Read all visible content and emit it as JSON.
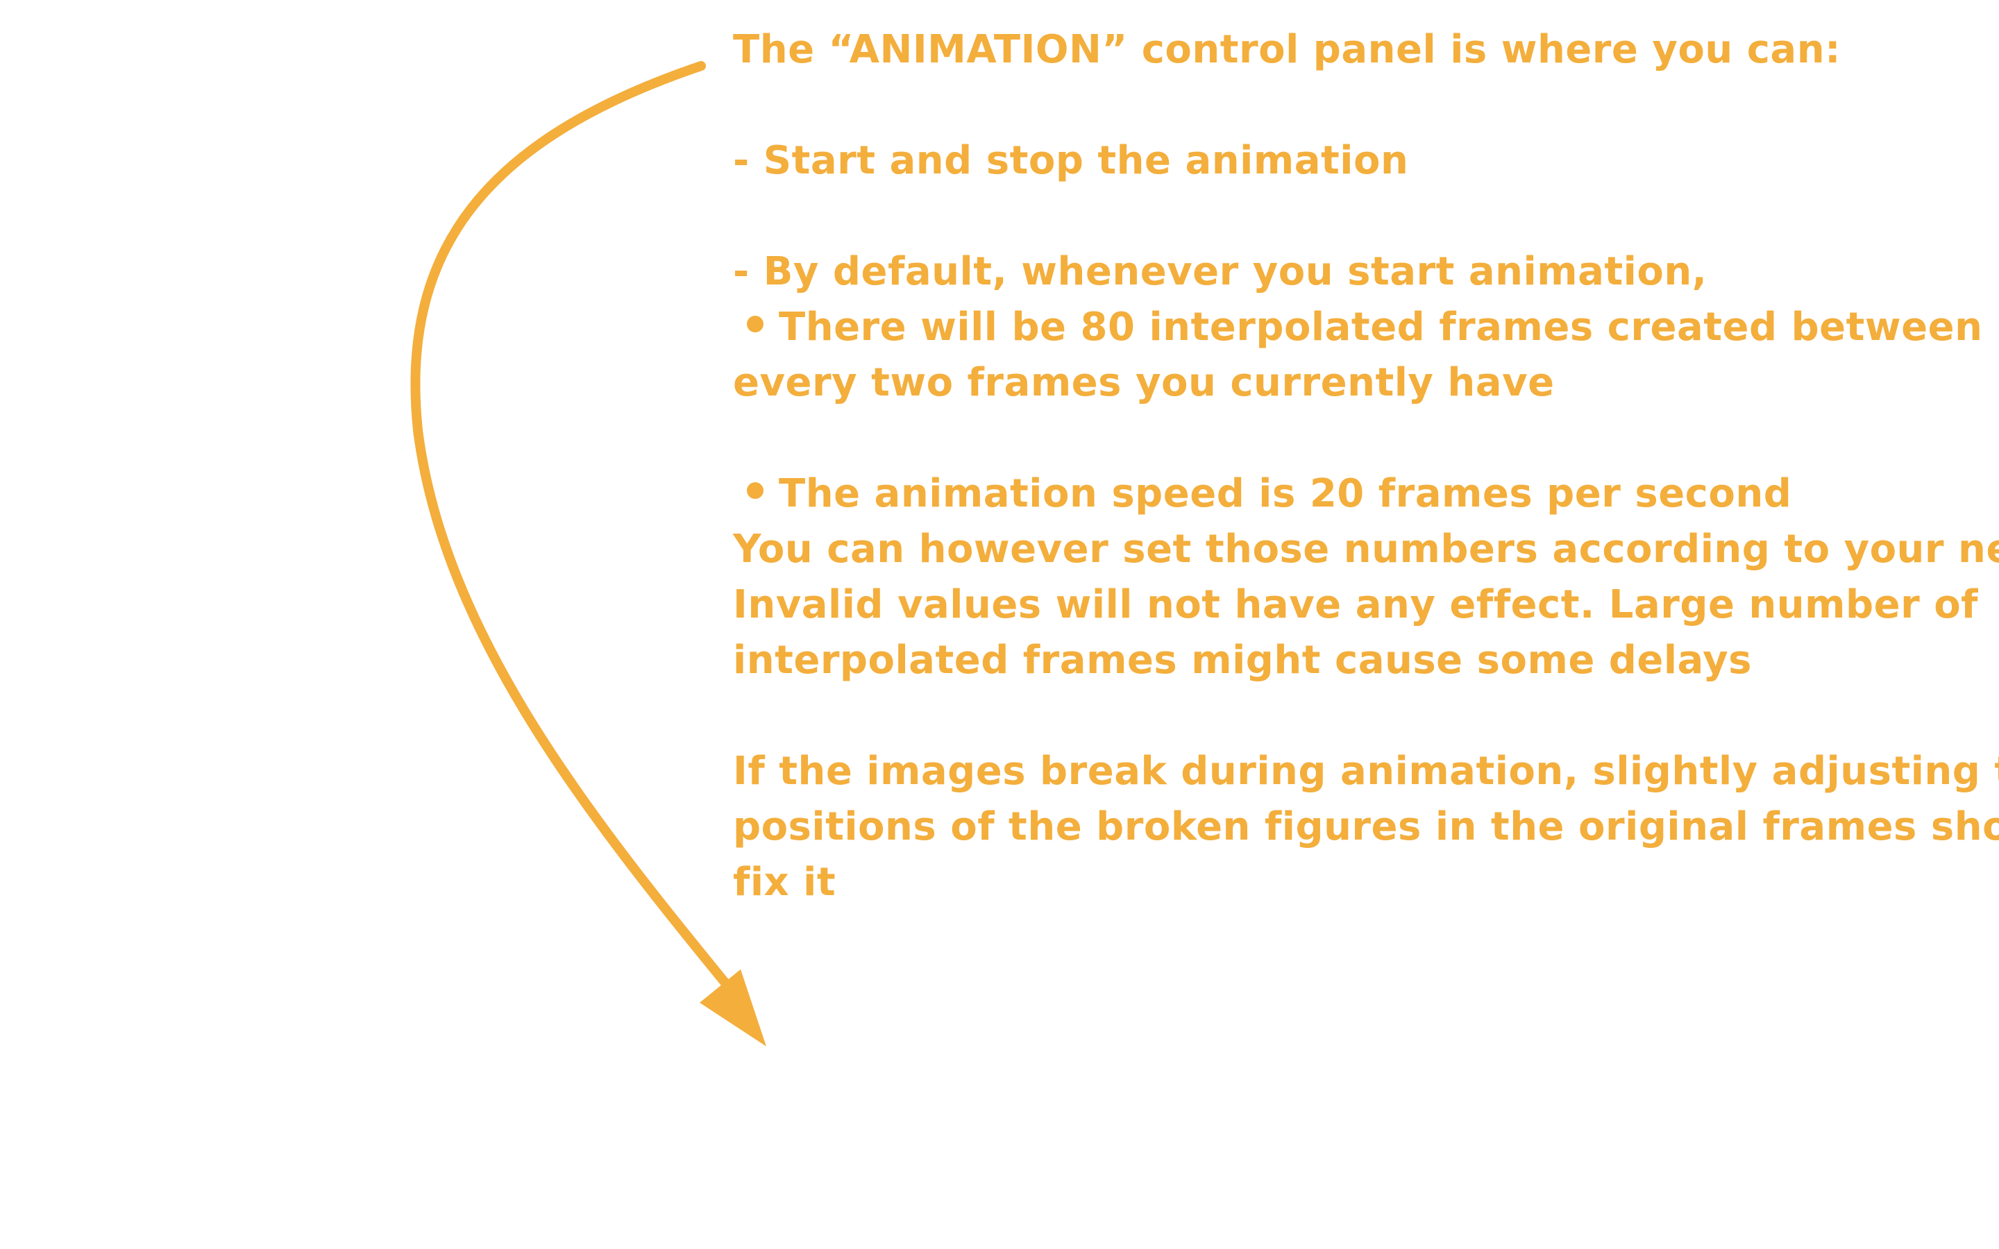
{
  "accent_color": "#f3ae3c",
  "arrow_icon": "curved-arrow-down-left",
  "help": {
    "intro": "The “ANIMATION” control panel is where you can:",
    "item_start_stop": "- Start and stop the animation",
    "item_default": "- By default, whenever you start animation,",
    "bullet_frames_line1": "There will be 80 interpolated frames created between",
    "bullet_frames_line2": "every two frames you currently have",
    "bullet_speed": "The animation speed is 20 frames per second",
    "note_line1": "You can however set those numbers according to your need.",
    "note_line2": "Invalid values will not have any effect. Large number of",
    "note_line3": "interpolated frames might cause some delays",
    "fix_line1": "If the images break during animation, slightly adjusting the",
    "fix_line2": "positions of the broken figures in the original frames should",
    "fix_line3": "fix it"
  }
}
